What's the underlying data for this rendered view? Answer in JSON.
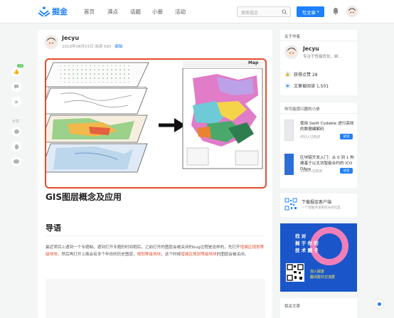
{
  "nav": {
    "logo_text": "掘金",
    "items": [
      "首页",
      "沸点",
      "话题",
      "小册",
      "活动"
    ],
    "search_placeholder": "搜索掘金",
    "write_label": "写文章",
    "brand_color": "#1e80ff"
  },
  "float_bar": {
    "like_count": "14",
    "share_label": "分享"
  },
  "article": {
    "author": "Jecyu",
    "meta": "2019年08月03日  阅读 680",
    "edit_label": "编辑",
    "hero_map_label": "Map",
    "title": "GIS图层概念及应用",
    "section_heading": "导语",
    "para_1": "最近项目上遇到一个专题制。遇到打开专题的时间稍后，之前打开的图层会被关闭的bug过程是这样的，先打开",
    "link_1": "增城区规划等级地块",
    "para_2": "，然后再打开上面会有多个年份的历史图层，",
    "link_2": "规划等级地块",
    "para_3": "，这个时候",
    "link_3": "增城区规划等级地块",
    "para_4": "的图层会被关闭。"
  },
  "sidebar": {
    "about_title": "关于作者",
    "about_name": "Jecyu",
    "about_desc": "专注于性能优化、前...",
    "likes_label": "获得点赞 28",
    "reads_label": "文章被阅读 1,501",
    "books_title": "你可能感兴趣的小册",
    "books": [
      {
        "title": "使用 Swift Codable 进行高效的数据编解码",
        "buyers": "450人已购买",
        "try": "试读",
        "color": "#e8eaee"
      },
      {
        "title": "区块链开发入门：从 0 到 1 构建基于以太坊智能合约的 ICO DApp",
        "buyers": "1486人已购买",
        "try": "试读",
        "color": "#2b6fd6"
      }
    ],
    "app_title": "下载掘金客户端",
    "app_sub": "一个帮助开发者成长的社区",
    "promo_lines": [
      "找 对",
      "掘 于 你 的",
      "技 术 圈 子"
    ],
    "promo_join": [
      "加入掘金",
      "翻译群共交流群"
    ],
    "related_title": "相关文章"
  }
}
